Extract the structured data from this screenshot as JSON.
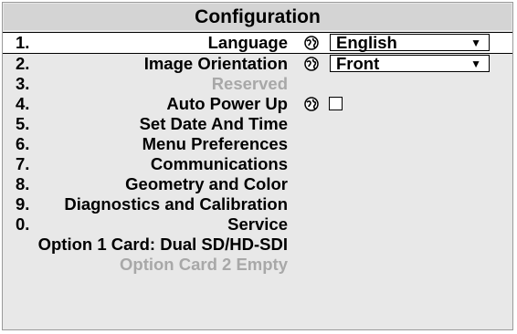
{
  "menu": {
    "title": "Configuration",
    "items": [
      {
        "num": "1.",
        "label": "Language",
        "control": "select",
        "value": "English"
      },
      {
        "num": "2.",
        "label": "Image Orientation",
        "control": "select",
        "value": "Front"
      },
      {
        "num": "3.",
        "label": "Reserved",
        "disabled": true
      },
      {
        "num": "4.",
        "label": "Auto Power Up",
        "control": "checkbox",
        "checked": false
      },
      {
        "num": "5.",
        "label": "Set Date And Time"
      },
      {
        "num": "6.",
        "label": "Menu Preferences"
      },
      {
        "num": "7.",
        "label": "Communications"
      },
      {
        "num": "8.",
        "label": "Geometry and Color"
      },
      {
        "num": "9.",
        "label": "Diagnostics and Calibration"
      },
      {
        "num": "0.",
        "label": "Service"
      }
    ],
    "info": [
      {
        "label": "Option 1 Card: Dual SD/HD-SDI",
        "disabled": false
      },
      {
        "label": "Option Card 2 Empty",
        "disabled": true
      }
    ],
    "dropdown_arrow": "▼",
    "icons": {
      "globe": "globe-icon"
    },
    "colors": {
      "background": "#e8e8e8",
      "title_bar": "#d4d4d4",
      "disabled_text": "#a8a8a8"
    }
  }
}
